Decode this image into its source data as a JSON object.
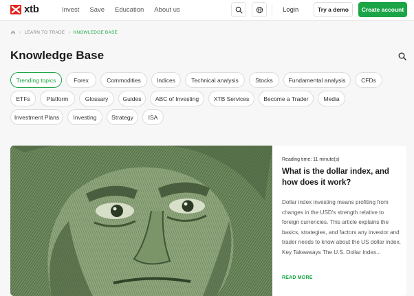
{
  "header": {
    "brand": "xtb",
    "nav": [
      "Invest",
      "Save",
      "Education",
      "About us"
    ],
    "login": "Login",
    "try_demo": "Try a demo",
    "create_account": "Create account",
    "icons": [
      "search-icon",
      "globe-icon"
    ]
  },
  "breadcrumb": {
    "items": [
      "LEARN TO TRADE",
      "KNOWLEDGE BASE"
    ],
    "home_icon": "home-icon"
  },
  "page": {
    "title": "Knowledge Base"
  },
  "topics": {
    "row1": [
      "Trending topics",
      "Forex",
      "Commodities",
      "Indices",
      "Technical analysis",
      "Stocks",
      "Fundamental analysis",
      "CFDs"
    ],
    "row2": [
      "ETFs",
      "Platform",
      "Glossary",
      "Guides",
      "ABC of Investing",
      "XTB Services",
      "Become a Trader",
      "Media"
    ],
    "row3": [
      "Investment Plans",
      "Investing",
      "Strategy",
      "ISA"
    ],
    "active": "Trending topics"
  },
  "article": {
    "reading_time": "Reading time: 11 minute(s)",
    "title": "What is the dollar index, and how does it work?",
    "excerpt": "Dollar index investing means profiting from changes in the USD's strength relative to foreign currencies. This article explains the basics, strategies, and factors any investor and trader needs to know about the US dollar index. Key Takeaways The U.S. Dollar Index...",
    "read_more": "READ MORE"
  },
  "colors": {
    "accent": "#1ba546",
    "logo_red": "#e3231c"
  }
}
